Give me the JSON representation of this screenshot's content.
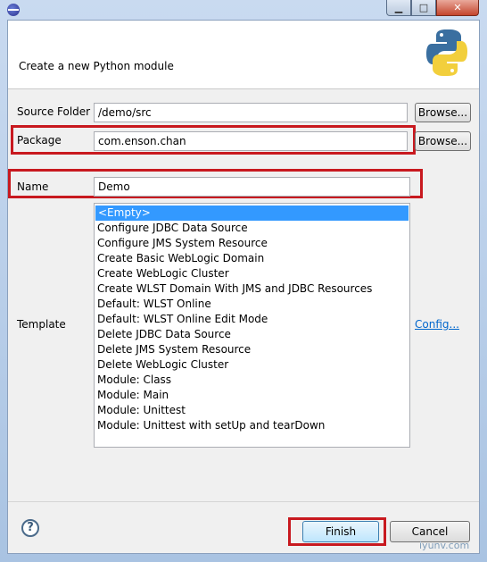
{
  "window": {
    "controls": {
      "minimize": "▁",
      "maximize": "□",
      "close": "✕"
    }
  },
  "header": {
    "title": "Create a new Python module"
  },
  "form": {
    "source_folder": {
      "label": "Source Folder",
      "value": "/demo/src",
      "browse": "Browse..."
    },
    "package": {
      "label": "Package",
      "value": "com.enson.chan",
      "browse": "Browse..."
    },
    "name": {
      "label": "Name",
      "value": "Demo"
    },
    "template": {
      "label": "Template",
      "config_link": "Config...",
      "items": [
        "<Empty>",
        "Configure JDBC Data Source",
        "Configure JMS System Resource",
        "Create Basic WebLogic Domain",
        "Create WebLogic Cluster",
        "Create WLST Domain With JMS and JDBC Resources",
        "Default: WLST Online",
        "Default: WLST Online Edit Mode",
        "Delete JDBC Data Source",
        "Delete JMS System Resource",
        "Delete WebLogic Cluster",
        "Module: Class",
        "Module: Main",
        "Module: Unittest",
        "Module: Unittest with setUp and tearDown"
      ],
      "selected_index": 0
    }
  },
  "footer": {
    "help": "?",
    "finish": "Finish",
    "cancel": "Cancel"
  },
  "watermark": "iyunv.com",
  "colors": {
    "highlight": "#c8191f",
    "selection": "#3399ff",
    "link": "#0066cc"
  }
}
